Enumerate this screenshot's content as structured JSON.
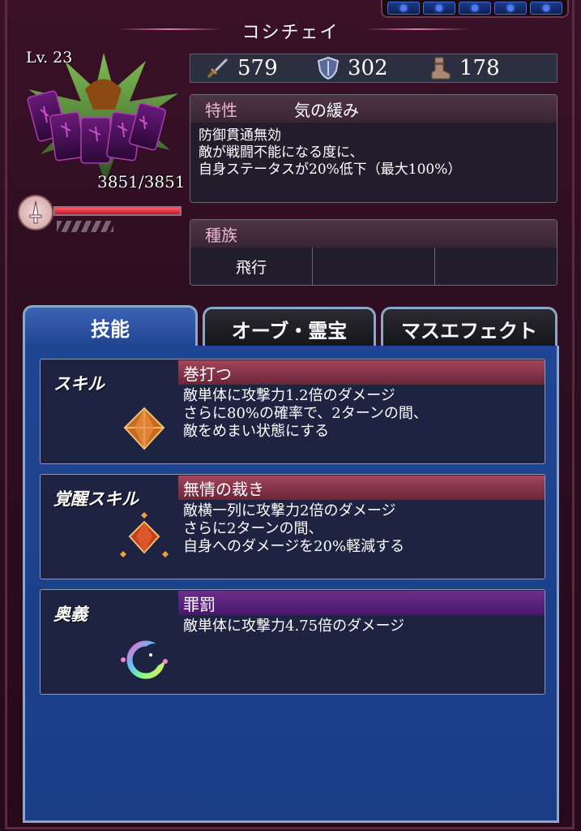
{
  "header": {
    "title": "コシチェイ"
  },
  "unit": {
    "level": "Lv. 23",
    "hp_text": "3851/3851",
    "hp_fraction": 1.0
  },
  "stats": {
    "attack": "579",
    "defense": "302",
    "speed": "178"
  },
  "traits": {
    "label": "特性",
    "name": "気の緩み",
    "lines": [
      "防御貫通無効",
      "敵が戦闘不能になる度に、",
      "自身ステータスが20%低下（最大100%）"
    ]
  },
  "race": {
    "label": "種族",
    "cells": [
      "飛行",
      "",
      ""
    ]
  },
  "tabs": [
    {
      "label": "技能"
    },
    {
      "label": "オーブ・霊宝"
    },
    {
      "label": "マスエフェクト"
    }
  ],
  "skills": [
    {
      "label": "スキル",
      "name": "巻打つ",
      "lines": [
        "敵単体に攻撃力1.2倍のダメージ",
        "さらに80%の確率で、2ターンの間、",
        "敵をめまい状態にする"
      ]
    },
    {
      "label": "覚醒スキル",
      "name": "無情の裁き",
      "lines": [
        "敵横一列に攻撃力2倍のダメージ",
        "さらに2ターンの間、",
        "自身へのダメージを20%軽減する"
      ]
    },
    {
      "label": "奥義",
      "name": "罪罰",
      "lines": [
        "敵単体に攻撃力4.75倍のダメージ"
      ]
    }
  ],
  "colors": {
    "accent_pink": "#e9b6d2",
    "tab_blue": "#1f4590",
    "hp_red": "#c0182c"
  }
}
